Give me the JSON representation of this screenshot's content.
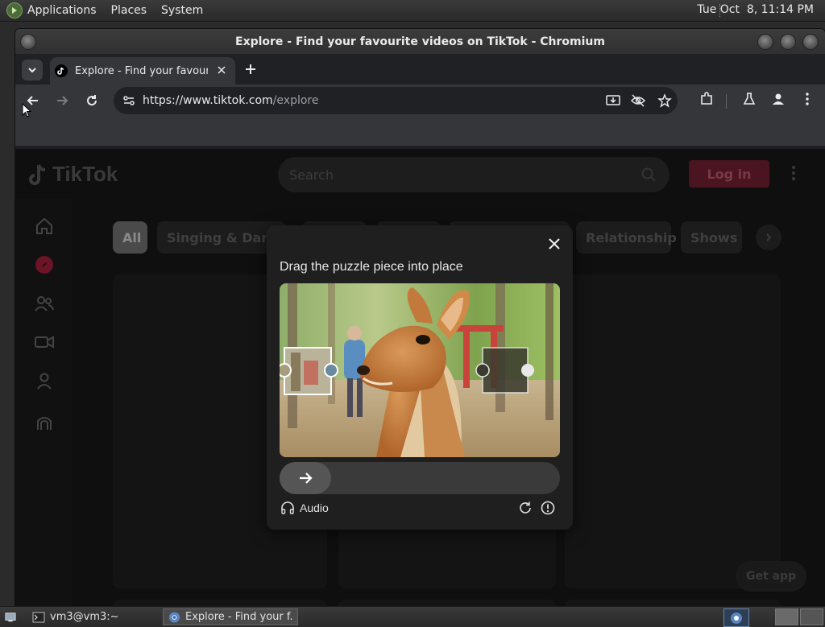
{
  "top_panel": {
    "menus": [
      "Applications",
      "Places",
      "System"
    ],
    "clock": "Tue Oct  8, 11:14 PM"
  },
  "window": {
    "title": "Explore - Find your favourite videos on TikTok - Chromium"
  },
  "browser": {
    "tab_title": "Explore - Find your favourite videos on TikTok",
    "url_host": "https://www.tiktok.com",
    "url_path": "/explore"
  },
  "tiktok": {
    "logo_text": "TikTok",
    "search_placeholder": "Search",
    "login_label": "Log in",
    "chips": [
      "All",
      "Singing & Dancing",
      "",
      "",
      "",
      "Relationship",
      "Shows"
    ],
    "get_app_label": "Get app"
  },
  "captcha": {
    "prompt": "Drag the puzzle piece into place",
    "audio_label": "Audio",
    "slider_progress": 0
  },
  "taskbar": {
    "terminal_label": "vm3@vm3:~",
    "chromium_label": "Explore - Find your f..."
  },
  "colors": {
    "tiktok_red": "#fe2c55",
    "chrome_dark": "#35363a",
    "omnibox": "#202124"
  }
}
